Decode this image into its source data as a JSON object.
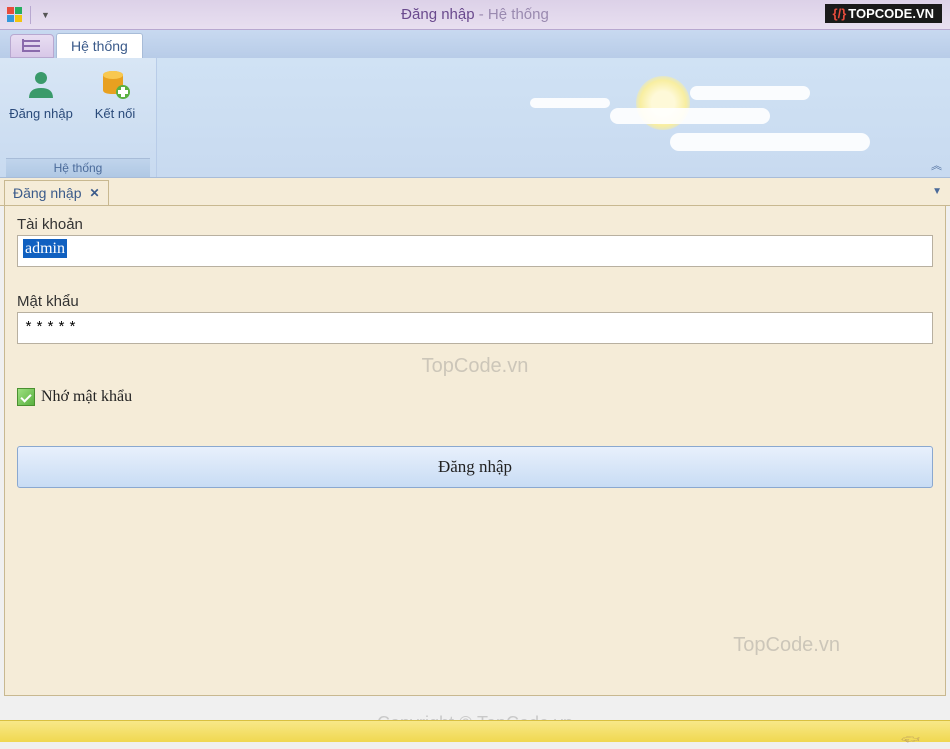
{
  "window": {
    "title_strong": "Đăng nhập",
    "title_sep": " - ",
    "title_light": "Hệ thống"
  },
  "badge": {
    "text": "TOPCODE.VN"
  },
  "ribbon": {
    "tab_system": "Hệ thống",
    "btn_login": "Đăng nhập",
    "btn_connect": "Kết nối",
    "group_label": "Hệ thống"
  },
  "content": {
    "tab_label": "Đăng nhập",
    "account_label": "Tài khoản",
    "account_value": "admin",
    "password_label": "Mật khẩu",
    "password_value": "*****",
    "remember_label": "Nhớ mật khẩu",
    "login_button": "Đăng nhập"
  },
  "watermarks": {
    "center": "TopCode.vn",
    "right": "TopCode.vn",
    "copyright": "Copyright © TopCode.vn"
  }
}
